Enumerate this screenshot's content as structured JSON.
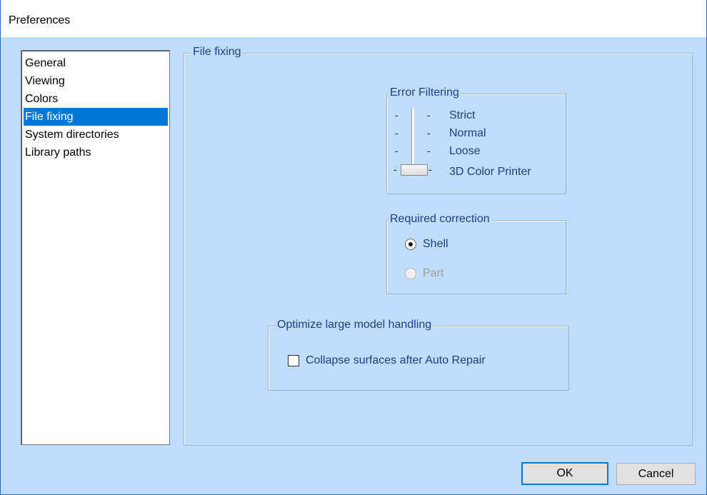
{
  "window": {
    "title": "Preferences"
  },
  "categories": [
    {
      "label": "General"
    },
    {
      "label": "Viewing"
    },
    {
      "label": "Colors"
    },
    {
      "label": "File fixing",
      "selected": true
    },
    {
      "label": "System directories"
    },
    {
      "label": "Library paths"
    }
  ],
  "file_fixing": {
    "title": "File fixing",
    "error_filtering": {
      "title": "Error Filtering",
      "levels": [
        "Strict",
        "Normal",
        "Loose",
        "3D Color Printer"
      ],
      "selected_level": "3D Color Printer",
      "tick": "-"
    },
    "required_correction": {
      "title": "Required correction",
      "options": [
        {
          "label": "Shell",
          "checked": true,
          "enabled": true
        },
        {
          "label": "Part",
          "checked": false,
          "enabled": false
        }
      ]
    },
    "large_model": {
      "title": "Optimize large model handling",
      "collapse_label": "Collapse surfaces after Auto Repair",
      "collapse_checked": false
    }
  },
  "buttons": {
    "ok": "OK",
    "cancel": "Cancel"
  },
  "colors": {
    "dialog_bg": "#bfdcfb",
    "accent_text": "#1f3d87",
    "selection": "#0078d7",
    "disabled_text": "#9c9c9c"
  }
}
